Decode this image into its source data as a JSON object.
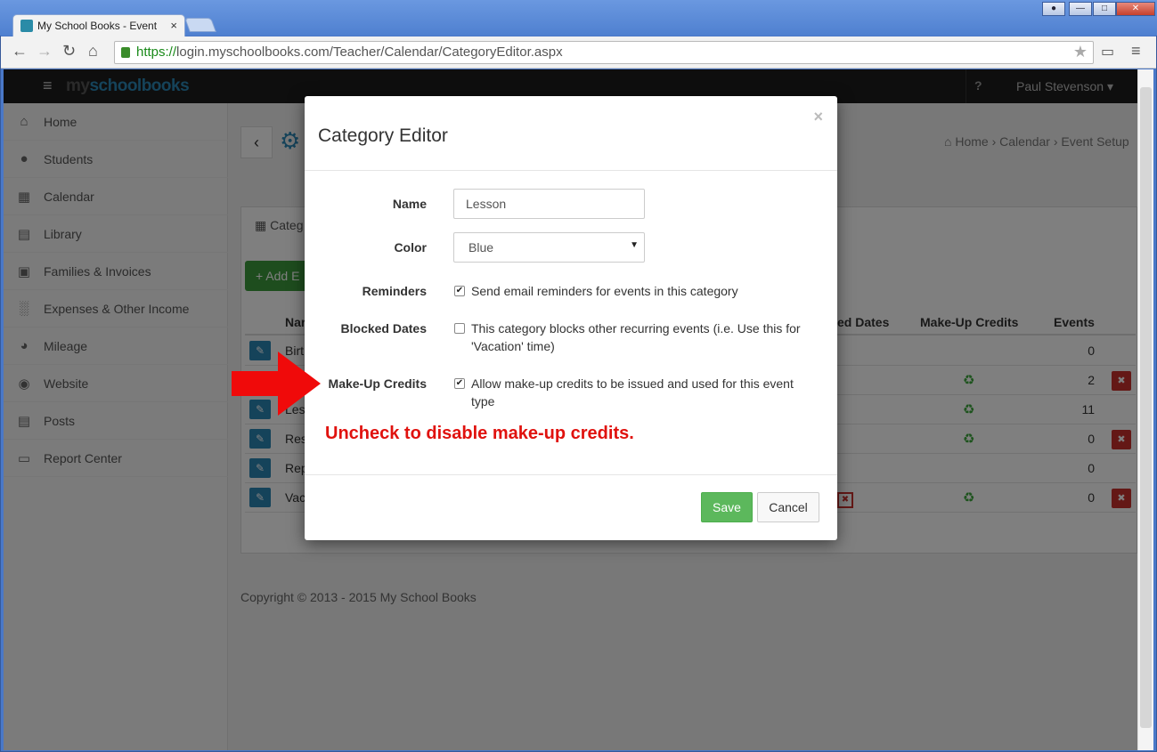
{
  "browser": {
    "tab_title": "My School Books - Event",
    "tab_close": "×",
    "url_proto": "https://",
    "url_rest": "login.myschoolbooks.com/Teacher/Calendar/CategoryEditor.aspx"
  },
  "app": {
    "logo_prefix": "my",
    "logo_main": "schoolbooks",
    "help_icon": "?",
    "user_name": "Paul Stevenson"
  },
  "sidebar": {
    "items": [
      {
        "label": "Home",
        "icon": "home-icon"
      },
      {
        "label": "Students",
        "icon": "users-icon"
      },
      {
        "label": "Calendar",
        "icon": "calendar-icon"
      },
      {
        "label": "Library",
        "icon": "book-icon"
      },
      {
        "label": "Families & Invoices",
        "icon": "money-icon"
      },
      {
        "label": "Expenses & Other Income",
        "icon": "bar-chart-icon"
      },
      {
        "label": "Mileage",
        "icon": "dashboard-icon"
      },
      {
        "label": "Website",
        "icon": "globe-icon"
      },
      {
        "label": "Posts",
        "icon": "newspaper-icon"
      },
      {
        "label": "Report Center",
        "icon": "file-icon"
      }
    ]
  },
  "page": {
    "breadcrumb": "Home › Calendar › Event Setup",
    "panel_tab": "Categ",
    "add_button": "+ Add E",
    "table_headers": {
      "name": "Nar",
      "blocked": "ed Dates",
      "makeup": "Make-Up Credits",
      "events": "Events"
    },
    "rows": [
      {
        "name": "Birt",
        "makeup": false,
        "events": "0",
        "deletable": false
      },
      {
        "name": "",
        "makeup": true,
        "events": "2",
        "deletable": true
      },
      {
        "name": "Les",
        "makeup": true,
        "events": "11",
        "deletable": false
      },
      {
        "name": "Res",
        "makeup": true,
        "events": "0",
        "deletable": true
      },
      {
        "name": "Rep",
        "makeup": false,
        "events": "0",
        "deletable": false
      },
      {
        "name": "Vac",
        "makeup": true,
        "events": "0",
        "deletable": true
      }
    ],
    "copyright": "Copyright © 2013 - 2015 My School Books"
  },
  "modal": {
    "title": "Category Editor",
    "close": "×",
    "name_label": "Name",
    "name_value": "Lesson",
    "color_label": "Color",
    "color_value": "Blue",
    "reminders_label": "Reminders",
    "reminders_text": "Send email reminders for events in this category",
    "reminders_checked": true,
    "blocked_label": "Blocked Dates",
    "blocked_text": "This category blocks other recurring events (i.e. Use this for 'Vacation' time)",
    "blocked_checked": false,
    "makeup_label": "Make-Up Credits",
    "makeup_text": "Allow make-up credits to be issued and used for this event type",
    "makeup_checked": true,
    "annotation": "Uncheck to disable make-up credits.",
    "save": "Save",
    "cancel": "Cancel"
  },
  "colors": {
    "accent": "#2a86b5",
    "save": "#5cb85c",
    "danger": "#c9302c",
    "annotation": "#e0120e"
  }
}
